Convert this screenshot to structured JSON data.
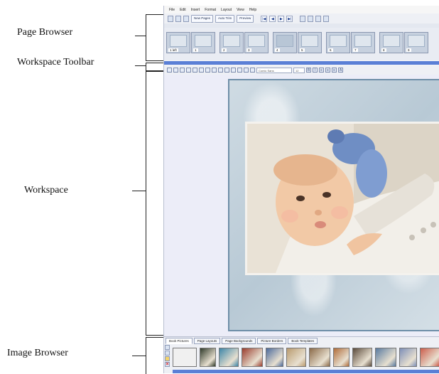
{
  "annotations": {
    "page_browser": "Page Browser",
    "workspace_toolbar": "Workspace Toolbar",
    "workspace": "Workspace",
    "image_browser": "Image Browser"
  },
  "menu": [
    "File",
    "Edit",
    "Insert",
    "Format",
    "Layout",
    "View",
    "Help"
  ],
  "toolbar": {
    "new_pages_label": "New Pages",
    "auto_trim_label": "Auto Trim",
    "preview_label": "Preview",
    "nav": [
      "|◀",
      "◀",
      "▶",
      "▶|"
    ]
  },
  "page_browser": {
    "pages": [
      "1 left",
      "1",
      "2",
      "3",
      "4",
      "5",
      "6",
      "7",
      "8",
      "9"
    ]
  },
  "workspace_toolbar": {
    "font_value": "Comic Sans",
    "size_value": "12",
    "format_buttons": [
      "B",
      "I",
      "≡",
      "≡",
      "≡",
      "A"
    ]
  },
  "image_browser": {
    "tabs": [
      "Book Pictures",
      "Page Layouts",
      "Page Backgrounds",
      "Picture Borders",
      "Book Templates"
    ],
    "active_tab": "Book Pictures",
    "thumb_colors": [
      "#f0f0f0",
      "#2f3a2a",
      "#3d86a8",
      "#9a3c2d",
      "#4c6a9c",
      "#b99b6f",
      "#8b6a48",
      "#b06c3a",
      "#5a4a3b",
      "#597aa0",
      "#7d8fb8",
      "#cc5d4c"
    ]
  },
  "colors": {
    "accent_scroll": "#5a7fd6",
    "workspace_bg": "#ecedf8",
    "page_border": "#6e8ea8"
  }
}
